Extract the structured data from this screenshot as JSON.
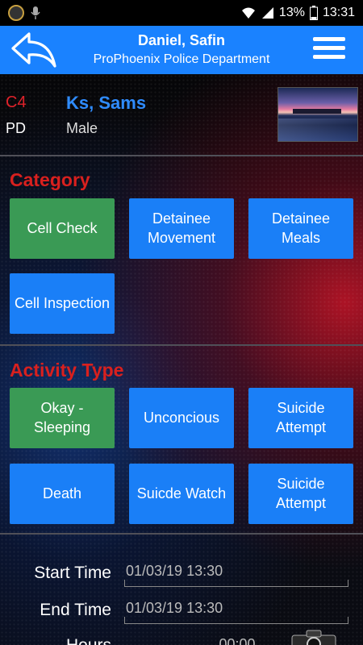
{
  "statusbar": {
    "battery": "13%",
    "time": "13:31"
  },
  "header": {
    "title": "Daniel, Safin",
    "subtitle": "ProPhoenix Police Department"
  },
  "inmate": {
    "code": "C4",
    "name": "Ks, Sams",
    "agency": "PD",
    "gender": "Male"
  },
  "category": {
    "title": "Category",
    "items": [
      {
        "label": "Cell Check",
        "selected": true
      },
      {
        "label": "Detainee Movement",
        "selected": false
      },
      {
        "label": "Detainee Meals",
        "selected": false
      },
      {
        "label": "Cell Inspection",
        "selected": false
      }
    ]
  },
  "activity": {
    "title": "Activity Type",
    "items": [
      {
        "label": "Okay - Sleeping",
        "selected": true
      },
      {
        "label": "Unconcious",
        "selected": false
      },
      {
        "label": "Suicide Attempt",
        "selected": false
      },
      {
        "label": "Death",
        "selected": false
      },
      {
        "label": "Suicde Watch",
        "selected": false
      },
      {
        "label": "Suicide Attempt",
        "selected": false
      }
    ]
  },
  "times": {
    "start_label": "Start Time",
    "start_value": "01/03/19 13:30",
    "end_label": "End Time",
    "end_value": "01/03/19 13:30",
    "hours_label": "Hours",
    "hours_value": "00:00"
  },
  "colors": {
    "header": "#1a82ff",
    "tile_blue": "#1a7ff7",
    "tile_selected": "#3a9a55",
    "section_title": "#d9201e",
    "name": "#2f8cff"
  }
}
